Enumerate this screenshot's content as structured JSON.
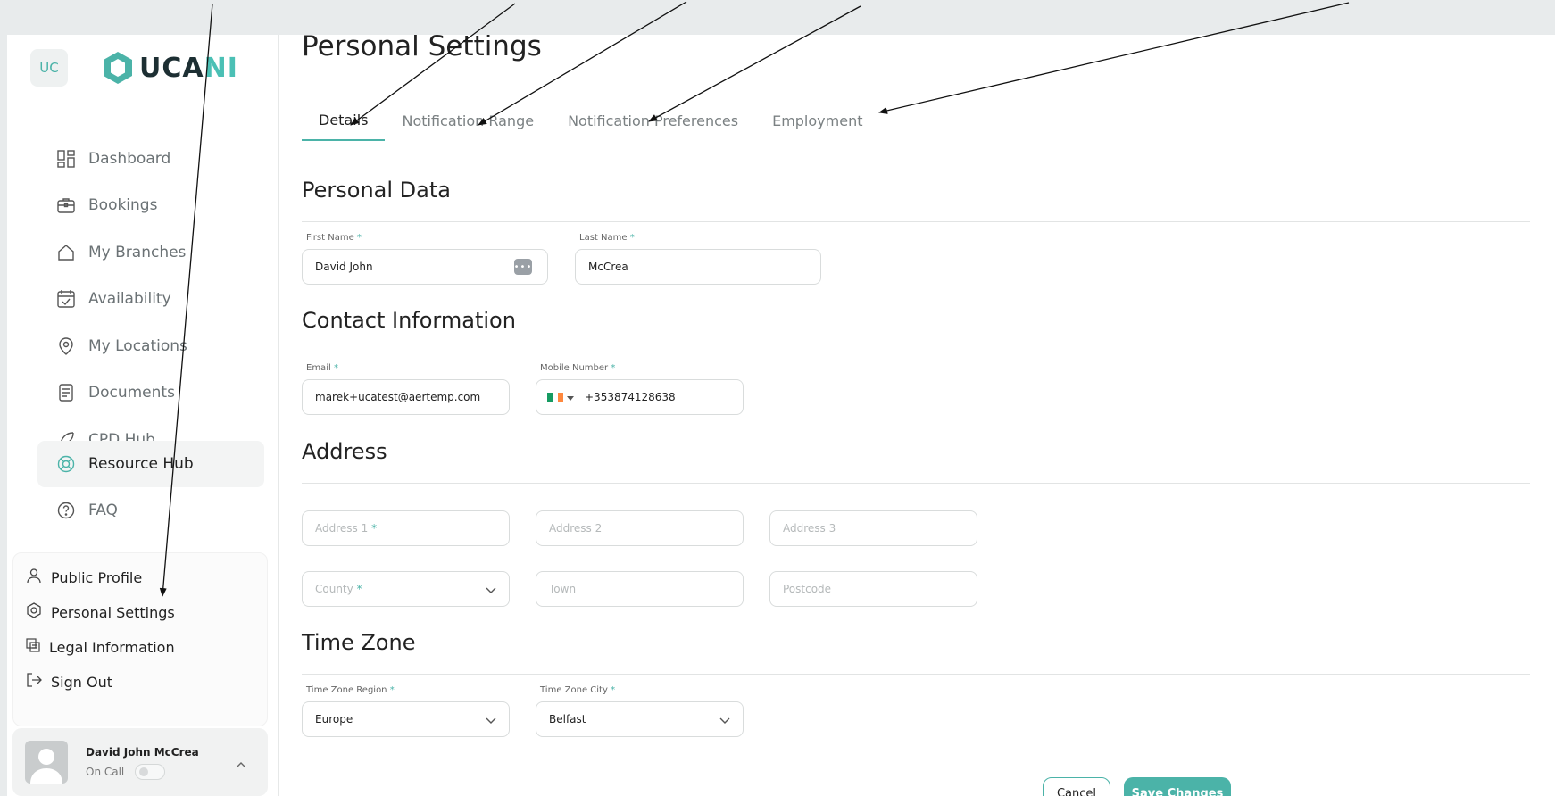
{
  "sidebar": {
    "badge": "UC",
    "logo_text_main": "UCA",
    "logo_text_accent": "NI",
    "items": [
      {
        "label": "Dashboard"
      },
      {
        "label": "Bookings"
      },
      {
        "label": "My Branches"
      },
      {
        "label": "Availability"
      },
      {
        "label": "My Locations"
      },
      {
        "label": "Documents"
      },
      {
        "label": "CPD Hub"
      },
      {
        "label": "Resource Hub"
      },
      {
        "label": "FAQ"
      }
    ],
    "menu": [
      {
        "label": "Public Profile"
      },
      {
        "label": "Personal Settings"
      },
      {
        "label": "Legal Information"
      },
      {
        "label": "Sign Out"
      }
    ],
    "user": {
      "name": "David John McCrea",
      "status": "On Call"
    }
  },
  "page": {
    "title": "Personal Settings",
    "tabs": [
      {
        "label": "Details"
      },
      {
        "label": "Notification Range"
      },
      {
        "label": "Notification Preferences"
      },
      {
        "label": "Employment"
      }
    ]
  },
  "personal": {
    "title": "Personal Data",
    "first_name_label": "First Name",
    "first_name": "David John",
    "last_name_label": "Last Name",
    "last_name": "McCrea"
  },
  "contact": {
    "title": "Contact Information",
    "email_label": "Email",
    "email": "marek+ucatest@aertemp.com",
    "mobile_label": "Mobile Number",
    "mobile": "+353874128638"
  },
  "address": {
    "title": "Address",
    "address1": "Address 1",
    "address2": "Address 2",
    "address3": "Address 3",
    "county": "County",
    "town": "Town",
    "postcode": "Postcode"
  },
  "timezone": {
    "title": "Time Zone",
    "region_label": "Time Zone Region",
    "region": "Europe",
    "city_label": "Time Zone City",
    "city": "Belfast"
  },
  "actions": {
    "cancel": "Cancel",
    "save": "Save Changes"
  },
  "required_mark": "*",
  "flag_colors": [
    "#169b62",
    "#ffffff",
    "#ff883e"
  ],
  "accent_color": "#4bb3a8"
}
